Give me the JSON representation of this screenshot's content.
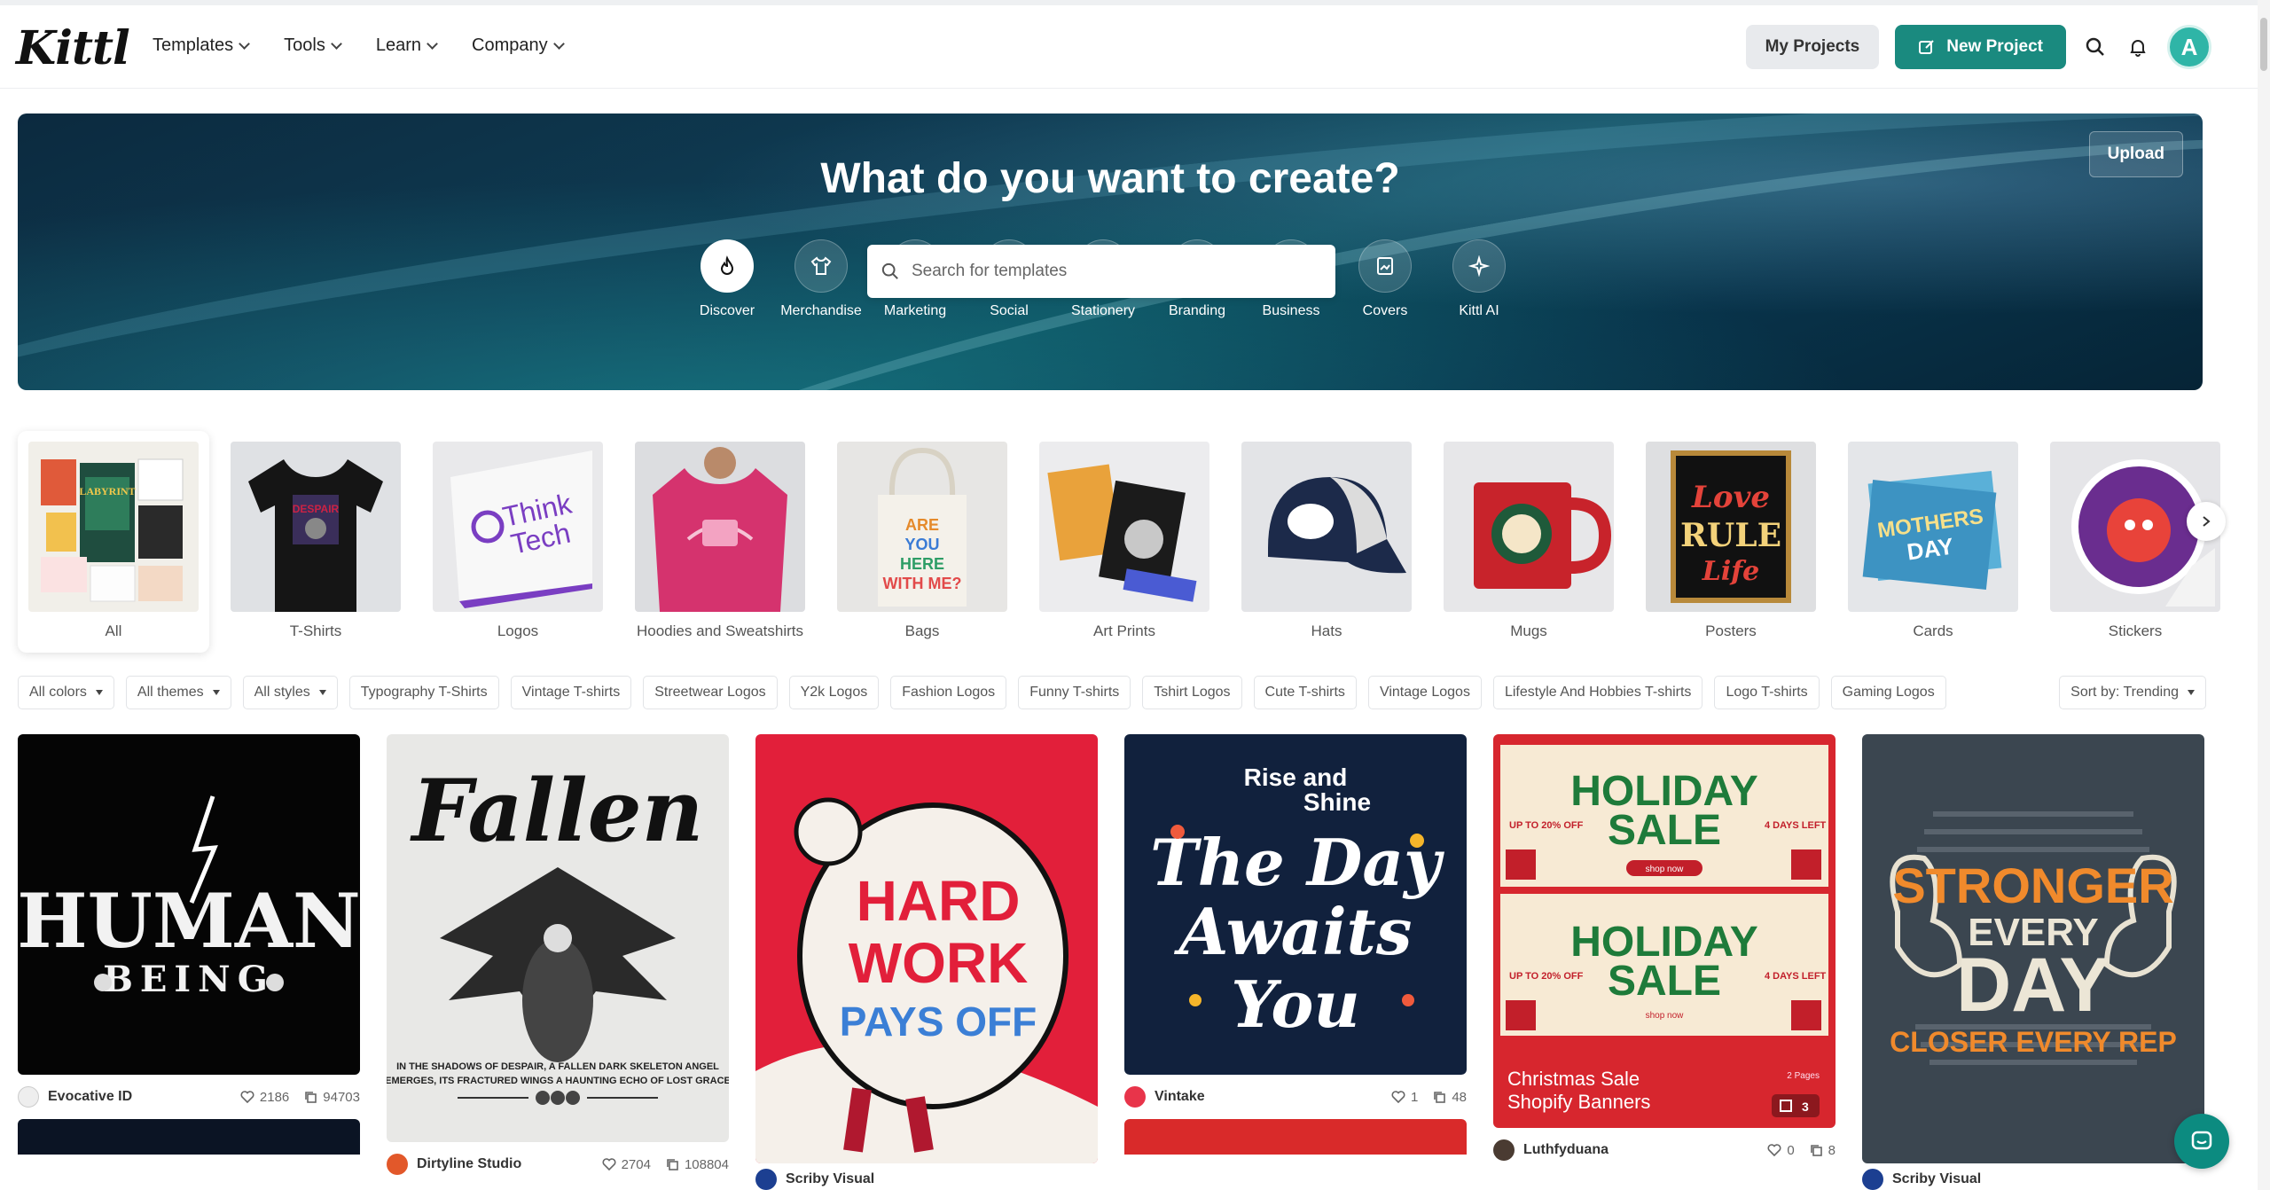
{
  "nav": {
    "logo": "Kittl",
    "menu": [
      {
        "label": "Templates"
      },
      {
        "label": "Tools"
      },
      {
        "label": "Learn"
      },
      {
        "label": "Company"
      }
    ],
    "my_projects": "My Projects",
    "new_project": "New Project",
    "avatar_letter": "A"
  },
  "hero": {
    "title": "What do you want to create?",
    "upload": "Upload",
    "categories": [
      {
        "label": "Discover",
        "icon": "flame-icon"
      },
      {
        "label": "Merchandise",
        "icon": "tshirt-icon"
      },
      {
        "label": "Marketing",
        "icon": "flyer-icon"
      },
      {
        "label": "Social",
        "icon": "thumbs-up-icon"
      },
      {
        "label": "Stationery",
        "icon": "notebook-icon"
      },
      {
        "label": "Branding",
        "icon": "pen-tool-icon"
      },
      {
        "label": "Business",
        "icon": "pie-chart-icon"
      },
      {
        "label": "Covers",
        "icon": "image-frame-icon"
      },
      {
        "label": "Kittl AI",
        "icon": "sparkle-icon"
      }
    ],
    "search_placeholder": "Search for templates"
  },
  "products": [
    {
      "label": "All"
    },
    {
      "label": "T-Shirts"
    },
    {
      "label": "Logos"
    },
    {
      "label": "Hoodies and Sweatshirts"
    },
    {
      "label": "Bags"
    },
    {
      "label": "Art Prints"
    },
    {
      "label": "Hats"
    },
    {
      "label": "Mugs"
    },
    {
      "label": "Posters"
    },
    {
      "label": "Cards"
    },
    {
      "label": "Stickers"
    }
  ],
  "filters": {
    "dropdowns": [
      "All colors",
      "All themes",
      "All styles"
    ],
    "tags": [
      "Typography T-Shirts",
      "Vintage T-shirts",
      "Streetwear Logos",
      "Y2k Logos",
      "Fashion Logos",
      "Funny T-shirts",
      "Tshirt Logos",
      "Cute T-shirts",
      "Vintage Logos",
      "Lifestyle And Hobbies T-shirts",
      "Logo T-shirts",
      "Gaming Logos"
    ],
    "sort": "Sort by: Trending"
  },
  "cards": [
    {
      "author": "Evocative ID",
      "likes": "2186",
      "copies": "94703",
      "art": [
        "HUMAN",
        "BEING"
      ]
    },
    {
      "author": "Dirtyline Studio",
      "likes": "2704",
      "copies": "108804",
      "art": [
        "Fallen",
        "IN THE SHADOWS OF DESPAIR, A FALLEN DARK SKELETON ANGEL",
        "EMERGES, ITS FRACTURED WINGS A HAUNTING ECHO OF LOST GRACE"
      ]
    },
    {
      "author": "Scriby Visual",
      "likes": "",
      "copies": "",
      "art": [
        "HARD",
        "WORK",
        "PAYS OFF"
      ]
    },
    {
      "author": "Vintake",
      "likes": "1",
      "copies": "48",
      "art": [
        "Rise and",
        "Shine",
        "The Day",
        "Awaits",
        "You"
      ]
    },
    {
      "author": "Luthfyduana",
      "likes": "0",
      "copies": "8",
      "art": [
        "HOLIDAY",
        "SALE",
        "UP TO 20% OFF",
        "4 DAYS LEFT",
        "shop now",
        "Christmas Sale",
        "Shopify Banners",
        "2 Pages",
        "3"
      ]
    },
    {
      "author": "Scriby Visual",
      "likes": "",
      "copies": "",
      "art": [
        "STRONGER",
        "EVERY",
        "DAY",
        "CLOSER EVERY REP"
      ]
    }
  ],
  "colors": {
    "accent": "#1a8a7f",
    "hero_dark": "#0c2a3f",
    "sale_red": "#d32f2f",
    "sale_green": "#1e7b3a"
  }
}
